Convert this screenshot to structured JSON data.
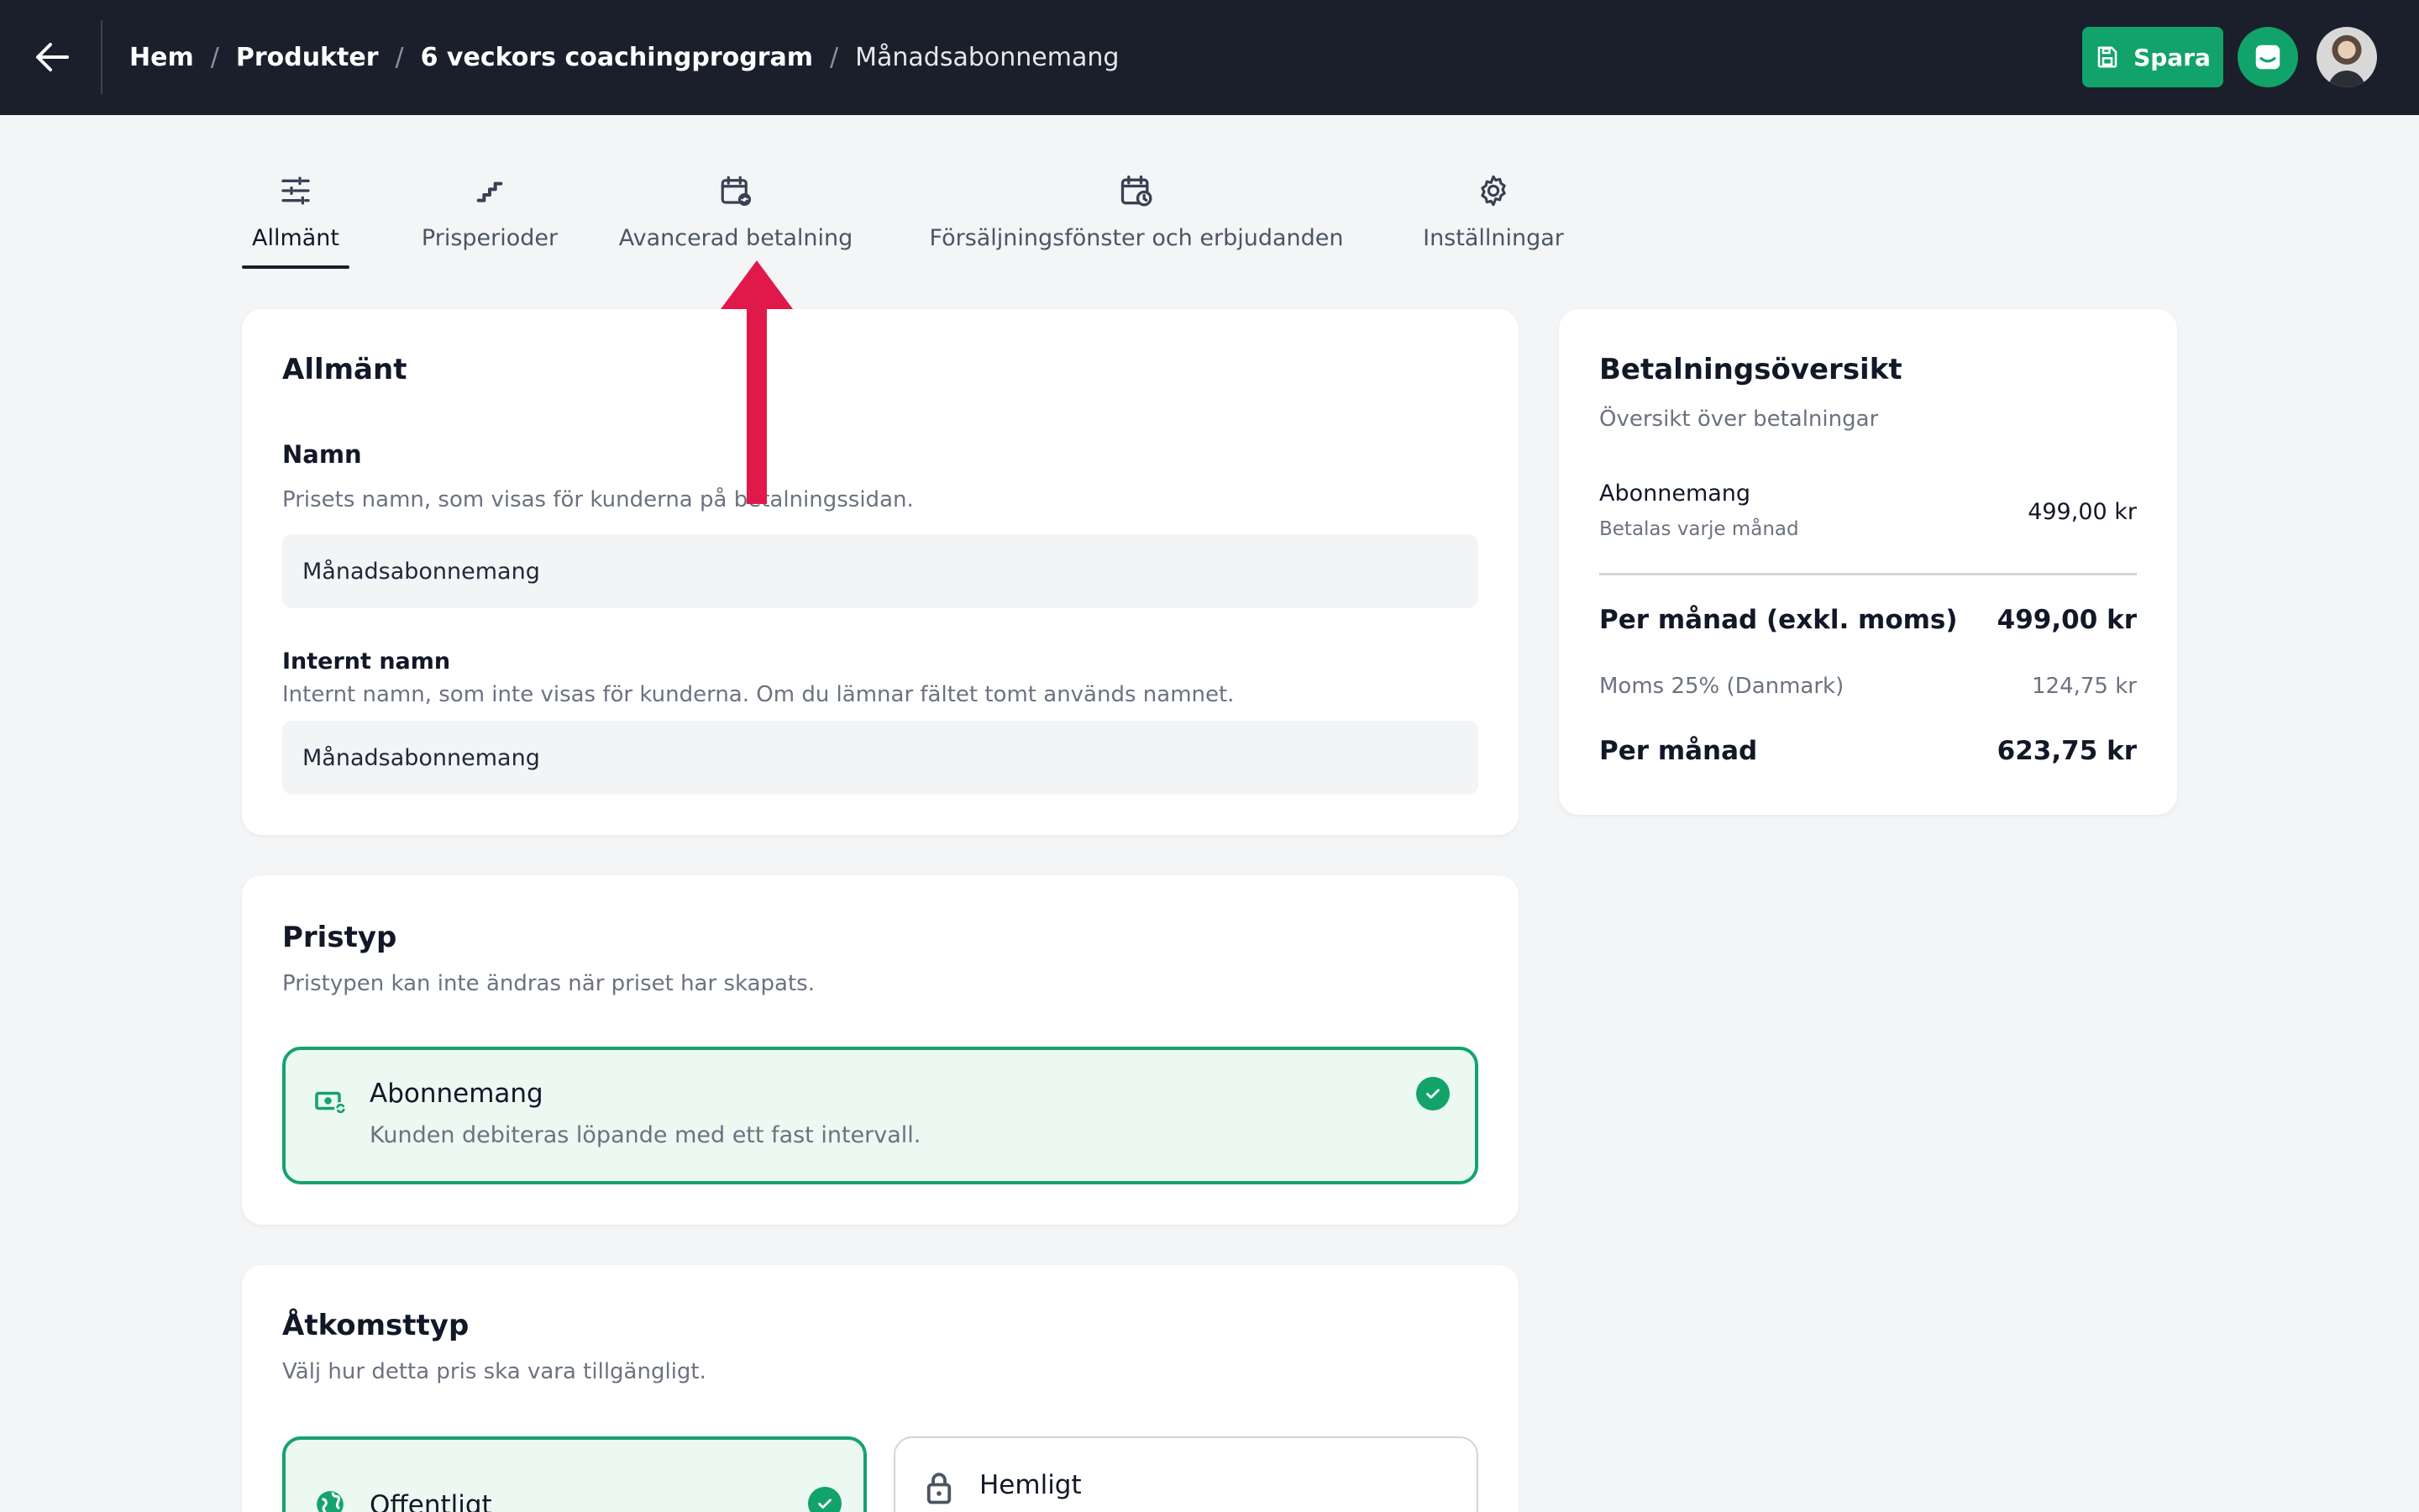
{
  "breadcrumb": {
    "items": [
      "Hem",
      "Produkter",
      "6 veckors coachingprogram"
    ],
    "current": "Månadsabonnemang"
  },
  "toolbar": {
    "save_label": "Spara"
  },
  "tabs": [
    {
      "label": "Allmänt",
      "icon": "sliders-icon",
      "active": true
    },
    {
      "label": "Prisperioder",
      "icon": "stairs-icon"
    },
    {
      "label": "Avancerad betalning",
      "icon": "calendar-refresh-icon"
    },
    {
      "label": "Försäljningsfönster och erbjudanden",
      "icon": "calendar-clock-icon"
    },
    {
      "label": "Inställningar",
      "icon": "gear-icon"
    }
  ],
  "general": {
    "title": "Allmänt",
    "name_label": "Namn",
    "name_help": "Prisets namn, som visas för kunderna på betalningssidan.",
    "name_value": "Månadsabonnemang",
    "internal_label": "Internt namn",
    "internal_help": "Internt namn, som inte visas för kunderna. Om du lämnar fältet tomt används namnet.",
    "internal_value": "Månadsabonnemang"
  },
  "price_type": {
    "title": "Pristyp",
    "help": "Pristypen kan inte ändras när priset har skapats.",
    "option_title": "Abonnemang",
    "option_desc": "Kunden debiteras löpande med ett fast intervall."
  },
  "access_type": {
    "title": "Åtkomsttyp",
    "help": "Välj hur detta pris ska vara tillgängligt.",
    "options": [
      {
        "label": "Offentligt",
        "selected": true
      },
      {
        "label": "Hemligt",
        "selected": false
      }
    ]
  },
  "summary": {
    "title": "Betalningsöversikt",
    "subtitle": "Översikt över betalningar",
    "item_name": "Abonnemang",
    "item_note": "Betalas varje månad",
    "item_price": "499,00 kr",
    "per_month_ex_label": "Per månad (exkl. moms)",
    "per_month_ex_value": "499,00 kr",
    "vat_label": "Moms 25% (Danmark)",
    "vat_value": "124,75 kr",
    "per_month_label": "Per månad",
    "per_month_value": "623,75 kr"
  },
  "colors": {
    "accent": "#11a36a",
    "topbar": "#1a1f2b",
    "annotation_arrow": "#e0194a"
  }
}
